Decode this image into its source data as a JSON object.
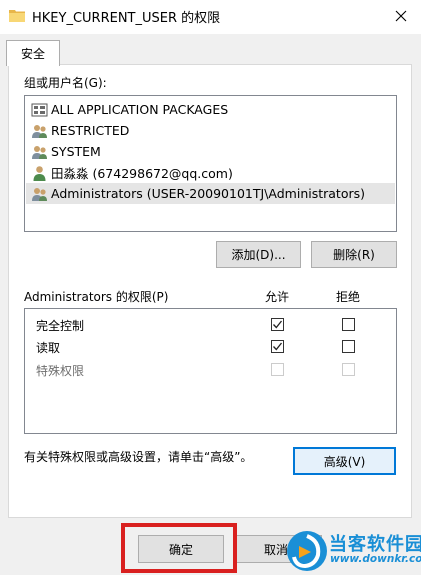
{
  "window": {
    "title": "HKEY_CURRENT_USER 的权限"
  },
  "tabs": [
    {
      "label": "安全",
      "active": true
    }
  ],
  "groups_label": "组或用户名(G):",
  "principals": [
    {
      "name": "ALL APPLICATION PACKAGES",
      "icon": "app-packages-icon"
    },
    {
      "name": "RESTRICTED",
      "icon": "group-icon"
    },
    {
      "name": "SYSTEM",
      "icon": "group-icon"
    },
    {
      "name": "田淼淼 (674298672@qq.com)",
      "icon": "user-icon"
    },
    {
      "name": "Administrators (USER-20090101TJ\\Administrators)",
      "icon": "group-icon",
      "selected": true
    }
  ],
  "buttons": {
    "add": "添加(D)...",
    "remove": "删除(R)",
    "advanced": "高级(V)",
    "ok": "确定",
    "cancel": "取消"
  },
  "permissions": {
    "header": "Administrators 的权限(P)",
    "allow_label": "允许",
    "deny_label": "拒绝",
    "rows": [
      {
        "name": "完全控制",
        "allow": true,
        "deny": false,
        "enabled": true
      },
      {
        "name": "读取",
        "allow": true,
        "deny": false,
        "enabled": true
      },
      {
        "name": "特殊权限",
        "allow": false,
        "deny": false,
        "enabled": false
      }
    ]
  },
  "advanced_hint": "有关特殊权限或高级设置，请单击“高级”。",
  "watermark": {
    "brand": "当客软件园",
    "url": "www.downkr.com"
  },
  "colors": {
    "accent": "#0078d7",
    "highlight_frame": "#d9201f",
    "logo": "#1a8fd6"
  }
}
